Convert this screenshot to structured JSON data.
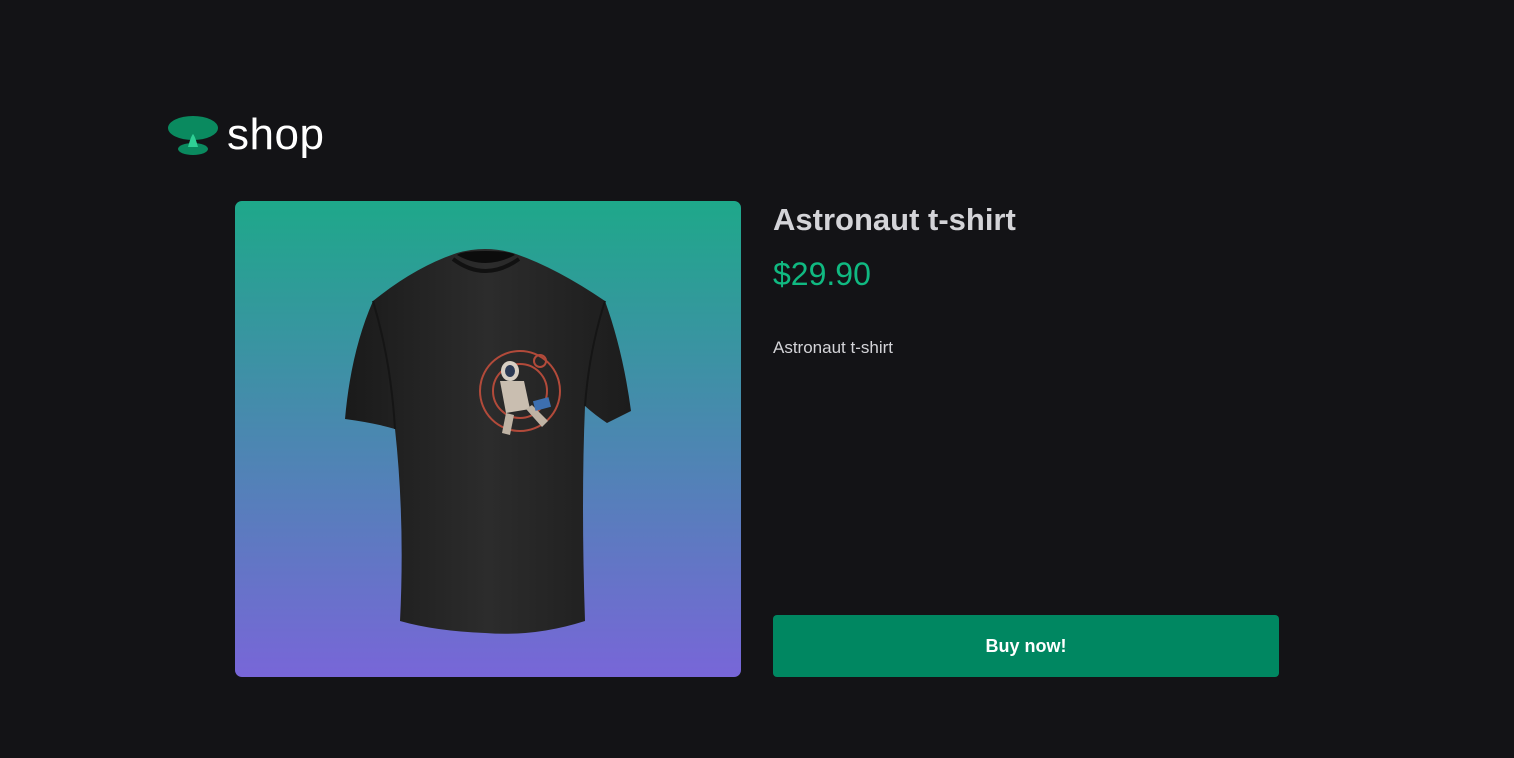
{
  "logo": {
    "icon": "mushroom-cloud-icon",
    "text": "shop",
    "color": "#0a8a5f"
  },
  "product": {
    "title": "Astronaut t-shirt",
    "price": "$29.90",
    "description": "Astronaut t-shirt",
    "image_icon": "tshirt-astronaut-image",
    "image_gradient": [
      "#1ea88a",
      "#7866d8"
    ]
  },
  "actions": {
    "buy_label": "Buy now!",
    "buy_color": "#008761"
  },
  "theme": {
    "background": "#131316",
    "accent": "#10b981",
    "text": "#d4d4d8"
  }
}
